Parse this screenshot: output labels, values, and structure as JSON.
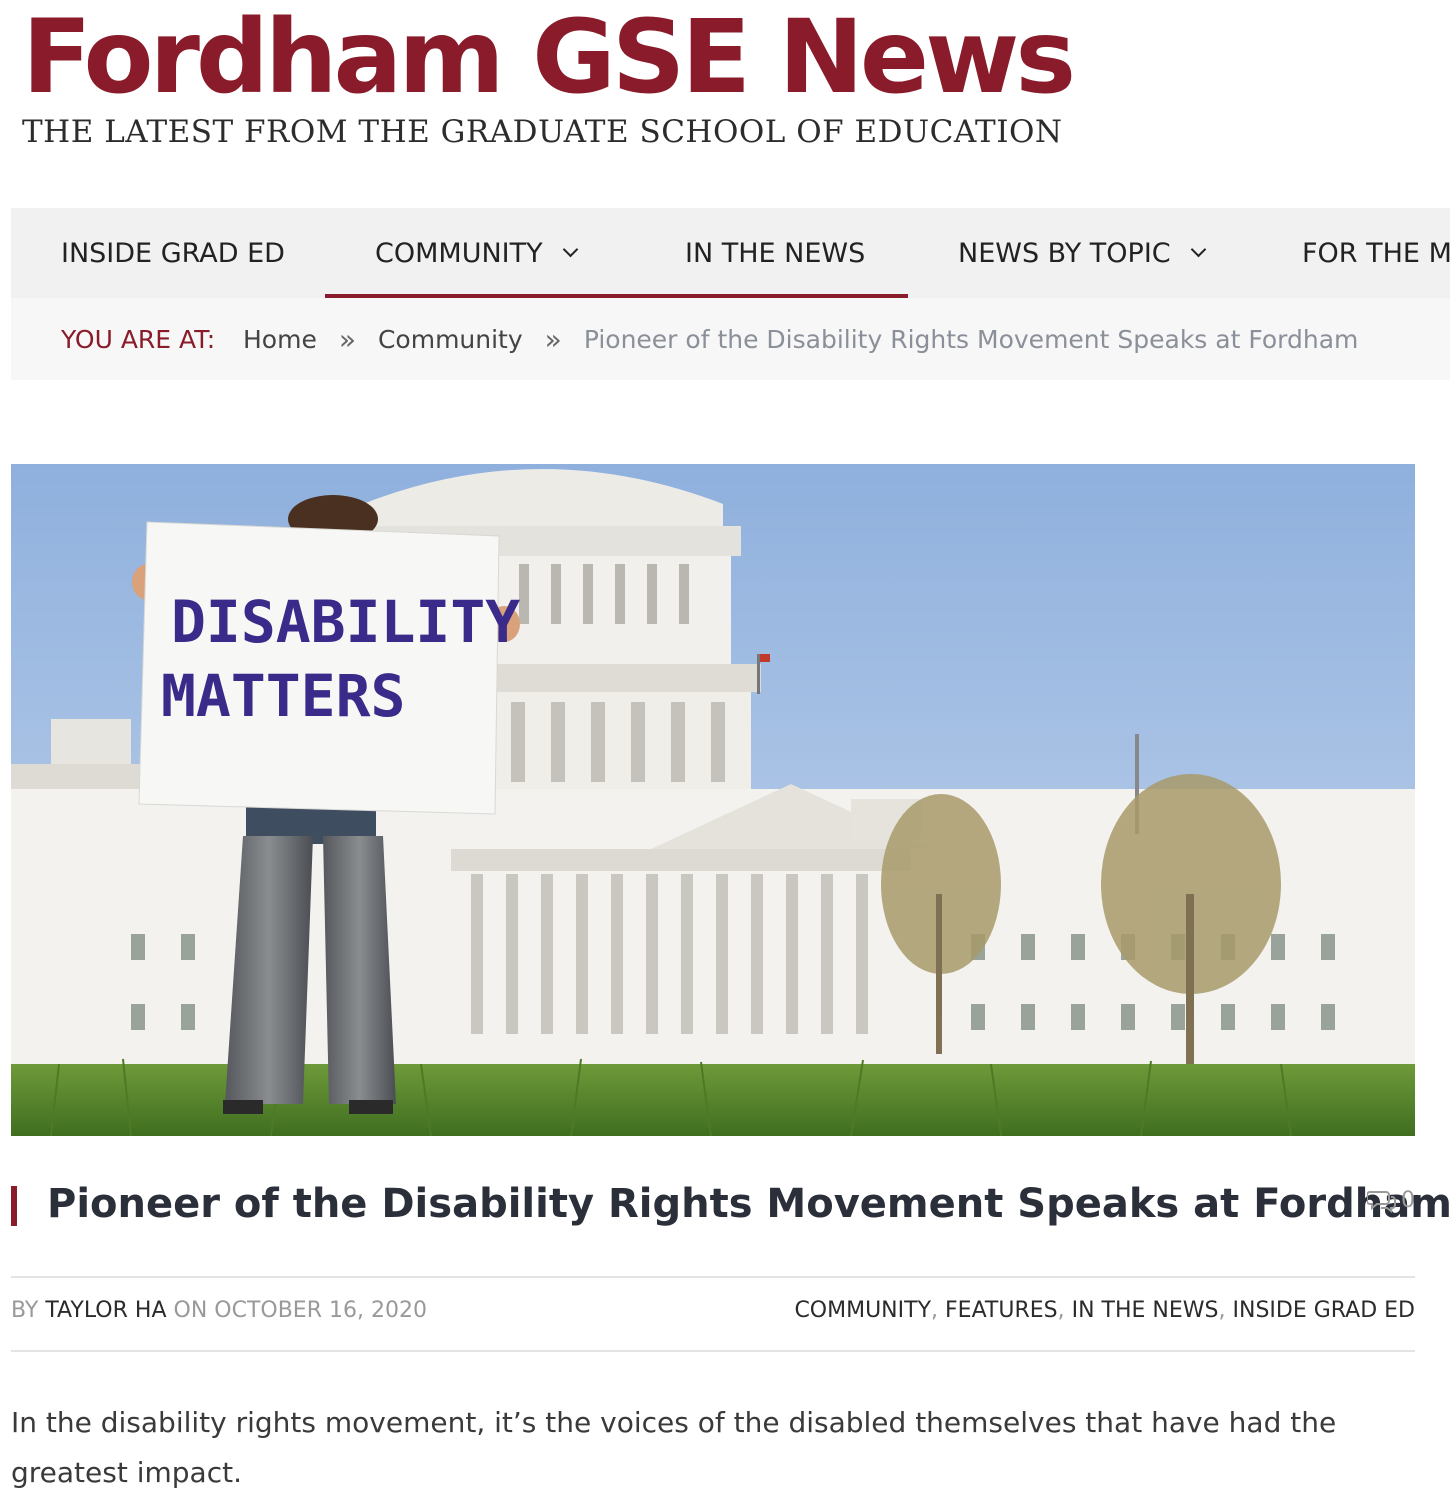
{
  "masthead": {
    "title": "Fordham GSE News",
    "tagline": "THE LATEST FROM THE GRADUATE SCHOOL OF EDUCATION"
  },
  "nav": {
    "items": [
      {
        "label": "INSIDE GRAD ED"
      },
      {
        "label": "COMMUNITY"
      },
      {
        "label": "IN THE NEWS"
      },
      {
        "label": "NEWS BY TOPIC"
      },
      {
        "label": "FOR THE MI"
      }
    ]
  },
  "breadcrumb": {
    "label": "YOU ARE AT:",
    "separator": "»",
    "home": "Home",
    "section": "Community",
    "current": "Pioneer of the Disability Rights Movement Speaks at Fordham"
  },
  "hero": {
    "sign_line1": "DISABILITY",
    "sign_line2": "MATTERS"
  },
  "article": {
    "title": "Pioneer of the Disability Rights Movement Speaks at Fordham",
    "comment_count": "0",
    "by": "BY",
    "author": "TAYLOR HA",
    "on": "ON",
    "date": "OCTOBER 16, 2020",
    "categories": [
      "COMMUNITY",
      "FEATURES",
      "IN THE NEWS",
      "INSIDE GRAD ED"
    ],
    "category_sep": ",",
    "intro": "In the disability rights movement, it’s the voices of the disabled themselves that have had the greatest impact."
  },
  "colors": {
    "brand": "#8a1b2a",
    "nav_bg": "#f1f1f1",
    "breadcrumb_bg": "#f7f7f7"
  }
}
